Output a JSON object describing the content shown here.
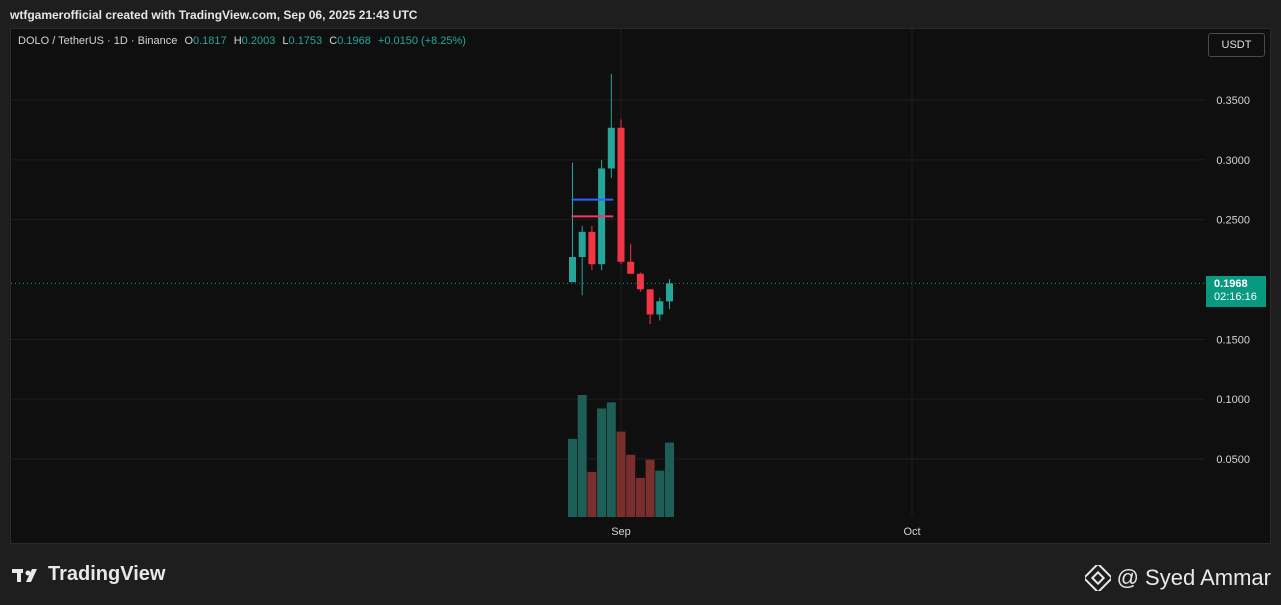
{
  "header": {
    "text": "wtfgamerofficial created with TradingView.com, Sep 06, 2025 21:43 UTC"
  },
  "legend": {
    "symbol": "DOLO / TetherUS · 1D · Binance",
    "o_label": "O",
    "o_value": "0.1817",
    "h_label": "H",
    "h_value": "0.2003",
    "l_label": "L",
    "l_value": "0.1753",
    "c_label": "C",
    "c_value": "0.1968",
    "change": "+0.0150 (+8.25%)"
  },
  "unit": "USDT",
  "price_tag": {
    "price": "0.1968",
    "countdown": "02:16:16"
  },
  "footer": {
    "brand": "TradingView",
    "credit": "@ Syed Ammar"
  },
  "colors": {
    "up": "#26a69a",
    "down": "#f23645",
    "vol_up": "#1d5e57",
    "vol_down": "#7a2e2e",
    "grid": "#1f1f1f",
    "blue_line": "#2962ff",
    "pink_line": "#f23668"
  },
  "chart_data": {
    "type": "candlestick",
    "ylim": [
      0,
      0.38
    ],
    "y_ticks": [
      "0.3500",
      "0.3000",
      "0.2500",
      "0.1500",
      "0.1000",
      "0.0500"
    ],
    "y_tick_values": [
      0.35,
      0.3,
      0.25,
      0.15,
      0.1,
      0.05
    ],
    "x_labels": [
      {
        "text": "Sep",
        "day": 0
      },
      {
        "text": "Oct",
        "day": 30
      }
    ],
    "last_price": 0.1968,
    "candles": [
      {
        "day": -5,
        "o": 0.1978,
        "h": 0.2976,
        "l": 0.2018,
        "c": 0.2188,
        "vol": 0.64
      },
      {
        "day": -4,
        "o": 0.2188,
        "h": 0.2448,
        "l": 0.1868,
        "c": 0.2398,
        "vol": 1.0
      },
      {
        "day": -3,
        "o": 0.2398,
        "h": 0.2448,
        "l": 0.2078,
        "c": 0.2128,
        "vol": 0.37
      },
      {
        "day": -2,
        "o": 0.2128,
        "h": 0.2998,
        "l": 0.2078,
        "c": 0.2928,
        "vol": 0.89
      },
      {
        "day": -1,
        "o": 0.2928,
        "h": 0.3718,
        "l": 0.2848,
        "c": 0.3268,
        "vol": 0.94
      },
      {
        "day": 0,
        "o": 0.3268,
        "h": 0.3338,
        "l": 0.2128,
        "c": 0.2148,
        "vol": 0.7
      },
      {
        "day": 1,
        "o": 0.2148,
        "h": 0.2298,
        "l": 0.2048,
        "c": 0.2048,
        "vol": 0.51
      },
      {
        "day": 2,
        "o": 0.2048,
        "h": 0.2058,
        "l": 0.1898,
        "c": 0.1918,
        "vol": 0.32
      },
      {
        "day": 3,
        "o": 0.1918,
        "h": 0.1918,
        "l": 0.1628,
        "c": 0.1708,
        "vol": 0.47
      },
      {
        "day": 4,
        "o": 0.1708,
        "h": 0.1848,
        "l": 0.1658,
        "c": 0.1818,
        "vol": 0.38
      },
      {
        "day": 5,
        "o": 0.1817,
        "h": 0.2003,
        "l": 0.1753,
        "c": 0.1968,
        "vol": 0.61
      }
    ],
    "lines": [
      {
        "color": "blue",
        "price": 0.2668,
        "from_day": -5,
        "to_day": -1
      },
      {
        "color": "pink",
        "price": 0.2528,
        "from_day": -5,
        "to_day": -1
      }
    ]
  }
}
